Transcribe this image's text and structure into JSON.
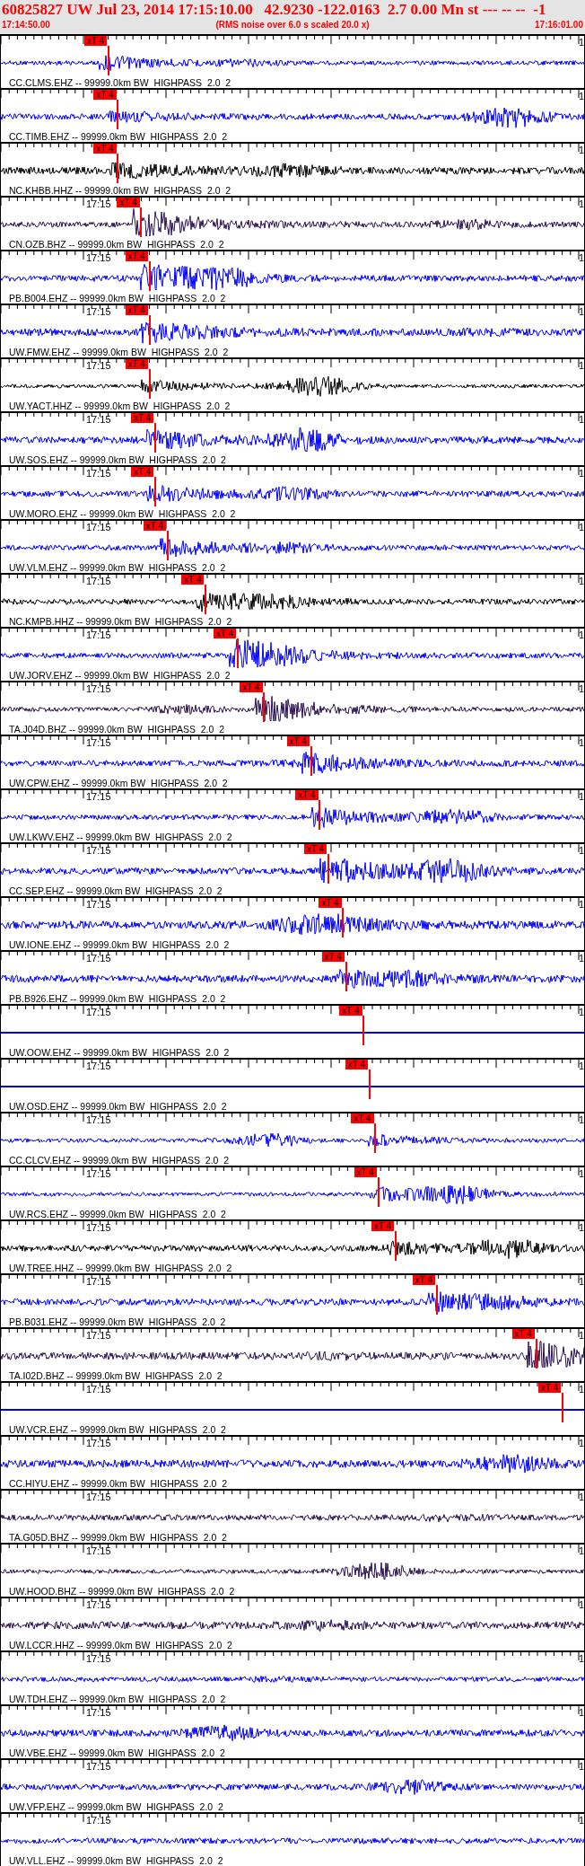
{
  "header": {
    "title": "60825827 UW Jul 23, 2014 17:15:10.00   42.9230 -122.0163  2.7 0.00 Mn st --- -- --  -1",
    "start_time": "17:14:50.00",
    "note": "(RMS noise over 6.0 s scaled 20.0 x)",
    "end_time": "17:16:01.00"
  },
  "traces": [
    {
      "label": "CC.CLMS.EHZ -- 99999.0km BW  HIGHPASS  2.0  2",
      "color": "#0000ff",
      "kind": "wave",
      "edge_label": "1",
      "pick": {
        "label": "xT 4",
        "level": 0.184
      }
    },
    {
      "label": "CC.TIMB.EHZ -- 99999.0km BW  HIGHPASS  2.0  2",
      "color": "#0000ff",
      "kind": "wave",
      "edge_label": "1",
      "pick": {
        "label": "xT 4",
        "level": 0.2
      }
    },
    {
      "label": "NC.KHBB.HHZ -- 99999.0km BW  HIGHPASS  2.0  2",
      "color": "#000000",
      "kind": "wave",
      "edge_label": "1",
      "pick": {
        "label": "xT 4",
        "level": 0.2
      }
    },
    {
      "label": "CN.OZB.BHZ -- 99999.0km BW  HIGHPASS  2.0  2",
      "color": "#2a1050",
      "kind": "wave",
      "time_label": "17:15",
      "edge_label": "1",
      "pick": {
        "label": "xT 4",
        "level": 0.24
      }
    },
    {
      "label": "PB.B004.EHZ -- 99999.0km BW  HIGHPASS  2.0  2",
      "color": "#0000ff",
      "kind": "wave",
      "time_label": "17:15",
      "edge_label": "1",
      "pick": {
        "label": "xT 4",
        "level": 0.254
      }
    },
    {
      "label": "UW.FMW.EHZ -- 99999.0km BW  HIGHPASS  2.0  2",
      "color": "#0000ff",
      "kind": "wave",
      "time_label": "17:15",
      "edge_label": "1",
      "pick": {
        "label": "xT 4",
        "level": 0.254
      }
    },
    {
      "label": "UW.YACT.HHZ -- 99999.0km BW  HIGHPASS  2.0  2",
      "color": "#000000",
      "kind": "wave",
      "time_label": "17:15",
      "edge_label": "1",
      "pick": {
        "label": "xT 4",
        "level": 0.254
      }
    },
    {
      "label": "UW.SOS.EHZ -- 99999.0km BW  HIGHPASS  2.0  2",
      "color": "#0000ff",
      "kind": "wave",
      "time_label": "17:15",
      "edge_label": "1",
      "pick": {
        "label": "xT 4",
        "level": 0.264
      }
    },
    {
      "label": "UW.MORO.EHZ -- 99999.0km BW  HIGHPASS  2.0  2",
      "color": "#0000ff",
      "kind": "wave",
      "time_label": "17:15",
      "edge_label": "1",
      "pick": {
        "label": "xT 4",
        "level": 0.264
      }
    },
    {
      "label": "UW.VLM.EHZ -- 99999.0km BW  HIGHPASS  2.0  2",
      "color": "#0000ff",
      "kind": "wave",
      "time_label": "17:15",
      "edge_label": "1",
      "pick": {
        "label": "xT 4",
        "level": 0.285
      }
    },
    {
      "label": "NC.KMPB.HHZ -- 99999.0km BW  HIGHPASS  2.0  2",
      "color": "#000000",
      "kind": "wave",
      "time_label": "17:15",
      "edge_label": "1",
      "pick": {
        "label": "xT 4",
        "level": 0.35
      }
    },
    {
      "label": "UW.JORV.EHZ -- 99999.0km BW  HIGHPASS  2.0  2",
      "color": "#0000ff",
      "kind": "wave",
      "time_label": "17:15",
      "edge_label": "1",
      "pick": {
        "label": "xT 4",
        "level": 0.405
      }
    },
    {
      "label": "TA.J04D.BHZ -- 99999.0km BW  HIGHPASS  2.0  2",
      "color": "#2a1050",
      "kind": "wave",
      "time_label": "17:15",
      "edge_label": "1",
      "pick": {
        "label": "xT 4",
        "level": 0.45
      }
    },
    {
      "label": "UW.CPW.EHZ -- 99999.0km BW  HIGHPASS  2.0  2",
      "color": "#0000ff",
      "kind": "wave",
      "time_label": "17:15",
      "edge_label": "1",
      "pick": {
        "label": "xT 4",
        "level": 0.53
      }
    },
    {
      "label": "UW.LKWV.EHZ -- 99999.0km BW  HIGHPASS  2.0  2",
      "color": "#0000ff",
      "kind": "wave",
      "time_label": "17:15",
      "edge_label": "1",
      "pick": {
        "label": "xT 4",
        "level": 0.545
      }
    },
    {
      "label": "CC.SEP.EHZ -- 99999.0km BW  HIGHPASS  2.0  2",
      "color": "#0000ff",
      "kind": "wave",
      "time_label": "17:15",
      "edge_label": "1",
      "pick": {
        "label": "xT 4",
        "level": 0.56
      }
    },
    {
      "label": "UW.IONE.EHZ -- 99999.0km BW  HIGHPASS  2.0  2",
      "color": "#0000ff",
      "kind": "wave",
      "time_label": "17:15",
      "edge_label": "1",
      "pick": {
        "label": "xT 4",
        "level": 0.585
      }
    },
    {
      "label": "PB.B926.EHZ -- 99999.0km BW  HIGHPASS  2.0  2",
      "color": "#0000ff",
      "kind": "wave",
      "time_label": "17:15",
      "edge_label": "1",
      "pick": {
        "label": "xT 4",
        "level": 0.59
      }
    },
    {
      "label": "UW.OOW.EHZ -- 99999.0km BW  HIGHPASS  2.0  2",
      "color": "#0000ff",
      "kind": "flat",
      "time_label": "17:15",
      "edge_label": "1",
      "pick": {
        "label": "xT 4",
        "level": 0.62
      }
    },
    {
      "label": "UW.OSD.EHZ -- 99999.0km BW  HIGHPASS  2.0  2",
      "color": "#0000ff",
      "kind": "flat",
      "time_label": "17:15",
      "edge_label": "1",
      "pick": {
        "label": "xT 4",
        "level": 0.63
      }
    },
    {
      "label": "CC.CLCV.EHZ -- 99999.0km BW  HIGHPASS  2.0  2",
      "color": "#0000ff",
      "kind": "wave",
      "time_label": "17:15",
      "edge_label": "1",
      "pick": {
        "label": "xT 4",
        "level": 0.64
      }
    },
    {
      "label": "UW.RCS.EHZ -- 99999.0km BW  HIGHPASS  2.0  2",
      "color": "#0000ff",
      "kind": "wave",
      "time_label": "17:15",
      "edge_label": "1",
      "pick": {
        "label": "xT 4",
        "level": 0.645
      }
    },
    {
      "label": "UW.TREE.HHZ -- 99999.0km BW  HIGHPASS  2.0  2",
      "color": "#000000",
      "kind": "wave",
      "time_label": "17:15",
      "edge_label": "1",
      "pick": {
        "label": "xT 4",
        "level": 0.675
      }
    },
    {
      "label": "PB.B031.EHZ -- 99999.0km BW  HIGHPASS  2.0  2",
      "color": "#0000ff",
      "kind": "wave",
      "time_label": "17:15",
      "edge_label": "1",
      "pick": {
        "label": "xT 4",
        "level": 0.745
      }
    },
    {
      "label": "TA.I02D.BHZ -- 99999.0km BW  HIGHPASS  2.0  2",
      "color": "#2a1050",
      "kind": "wave",
      "time_label": "17:15",
      "edge_label": "1",
      "pick": {
        "label": "xT 4",
        "level": 0.915
      }
    },
    {
      "label": "UW.VCR.EHZ -- 99999.0km BW  HIGHPASS  2.0  2",
      "color": "#0000ff",
      "kind": "flat",
      "time_label": "17:15",
      "edge_label": "1",
      "pick": {
        "label": "xT 4",
        "level": 0.96
      }
    },
    {
      "label": "CC.HIYU.EHZ -- 99999.0km BW  HIGHPASS  2.0  2",
      "color": "#0000ff",
      "kind": "wave",
      "time_label": "17:15",
      "edge_label": "1"
    },
    {
      "label": "TA.G05D.BHZ -- 99999.0km BW  HIGHPASS  2.0  2",
      "color": "#2a1050",
      "kind": "wave",
      "time_label": "17:15",
      "edge_label": "1"
    },
    {
      "label": "UW.HOOD.BHZ -- 99999.0km BW  HIGHPASS  2.0  2",
      "color": "#2a1050",
      "kind": "wave",
      "time_label": "17:15",
      "edge_label": "1"
    },
    {
      "label": "UW.LCCR.HHZ -- 99999.0km BW  HIGHPASS  2.0  2",
      "color": "#2a1050",
      "kind": "wave",
      "time_label": "17:15",
      "edge_label": "1"
    },
    {
      "label": "UW.TDH.EHZ -- 99999.0km BW  HIGHPASS  2.0  2",
      "color": "#0000ff",
      "kind": "wave",
      "time_label": "17:15",
      "edge_label": "1"
    },
    {
      "label": "UW.VBE.EHZ -- 99999.0km BW  HIGHPASS  2.0  2",
      "color": "#0000ff",
      "kind": "wave",
      "time_label": "17:15",
      "edge_label": "1"
    },
    {
      "label": "UW.VFP.EHZ -- 99999.0km BW  HIGHPASS  2.0  2",
      "color": "#0000ff",
      "kind": "wave",
      "time_label": "17:15",
      "edge_label": "1"
    },
    {
      "label": "UW.VLL.EHZ -- 99999.0km BW  HIGHPASS  2.0  2",
      "color": "#0000ff",
      "kind": "wave",
      "time_label": "17:15",
      "edge_label": "1"
    }
  ]
}
